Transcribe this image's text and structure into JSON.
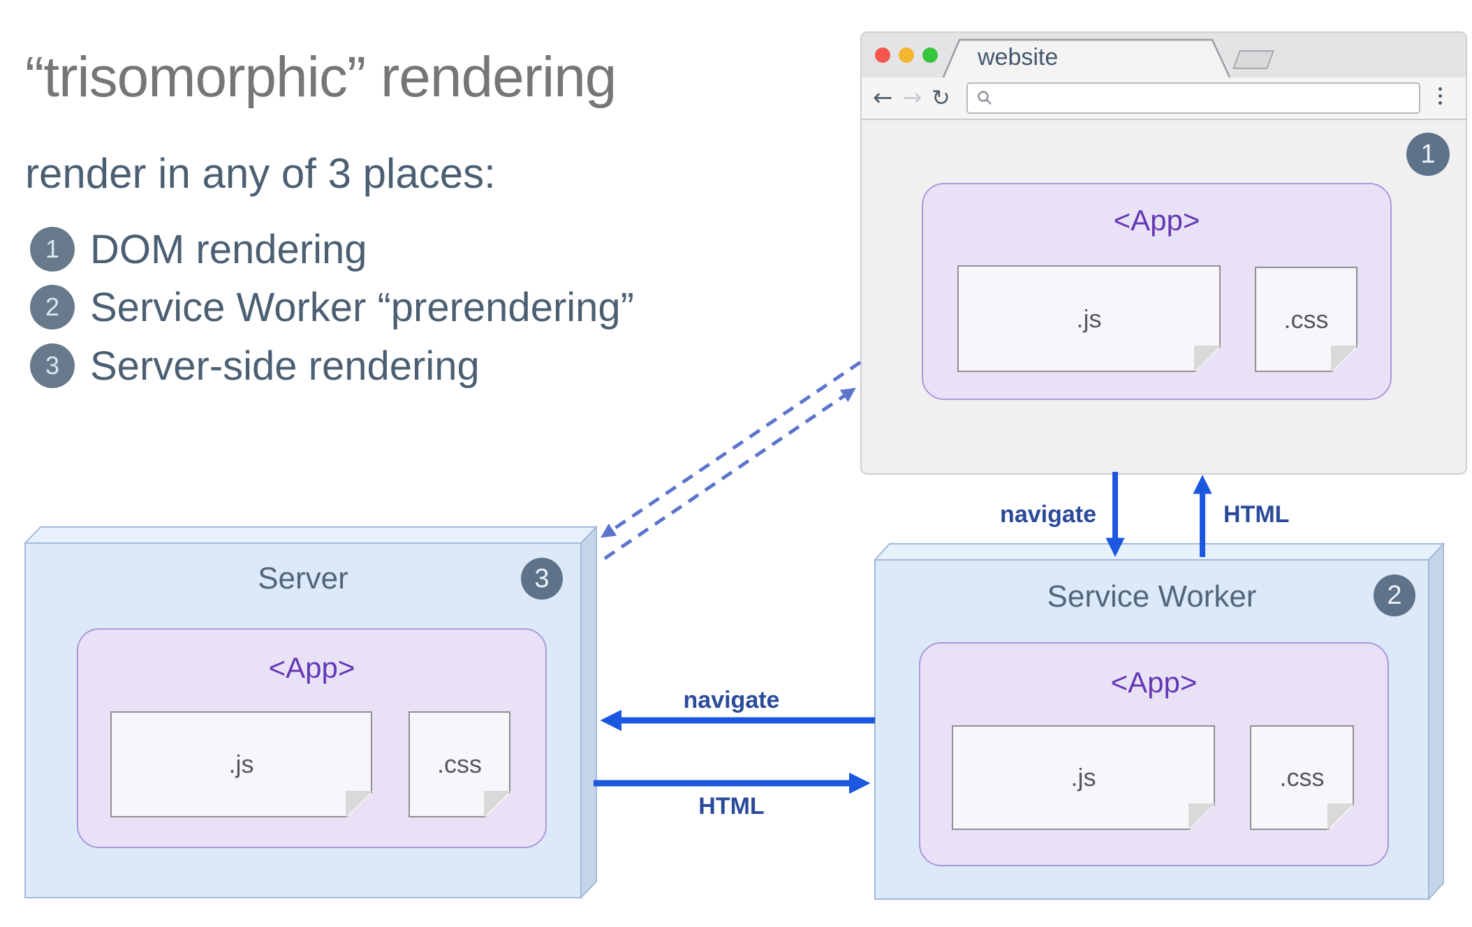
{
  "heading": {
    "title": "“trisomorphic” rendering",
    "subtitle": "render in any of 3 places:"
  },
  "legend": [
    {
      "num": "1",
      "label": "DOM rendering"
    },
    {
      "num": "2",
      "label": "Service Worker “prerendering”"
    },
    {
      "num": "3",
      "label": "Server-side rendering"
    }
  ],
  "browser": {
    "tab_title": "website",
    "badge": "1",
    "app": {
      "label": "<App>",
      "files": [
        ".js",
        ".css"
      ]
    }
  },
  "server": {
    "title": "Server",
    "badge": "3",
    "app": {
      "label": "<App>",
      "files": [
        ".js",
        ".css"
      ]
    }
  },
  "service_worker": {
    "title": "Service Worker",
    "badge": "2",
    "app": {
      "label": "<App>",
      "files": [
        ".js",
        ".css"
      ]
    }
  },
  "flows": {
    "browser_sw_down": "navigate",
    "browser_sw_up": "HTML",
    "sw_server_left": "navigate",
    "server_sw_right": "HTML"
  },
  "icons": {
    "back": "←",
    "forward": "→",
    "reload": "↻"
  },
  "colors": {
    "arrow_blue": "#1c57e0",
    "arrow_label": "#2a4a9a",
    "dashed_indigo": "#5c75cc",
    "badge_slate": "#5e7389",
    "app_purple": "#6438b5",
    "box_blue_front": "#dce9f9",
    "box_blue_top": "#e7f1fc",
    "box_blue_side": "#c6d4ea",
    "panel_lavender": "#e9e2f7",
    "traffic_red": "#f4574f",
    "traffic_yellow": "#f5b62f",
    "traffic_green": "#38c53e"
  }
}
